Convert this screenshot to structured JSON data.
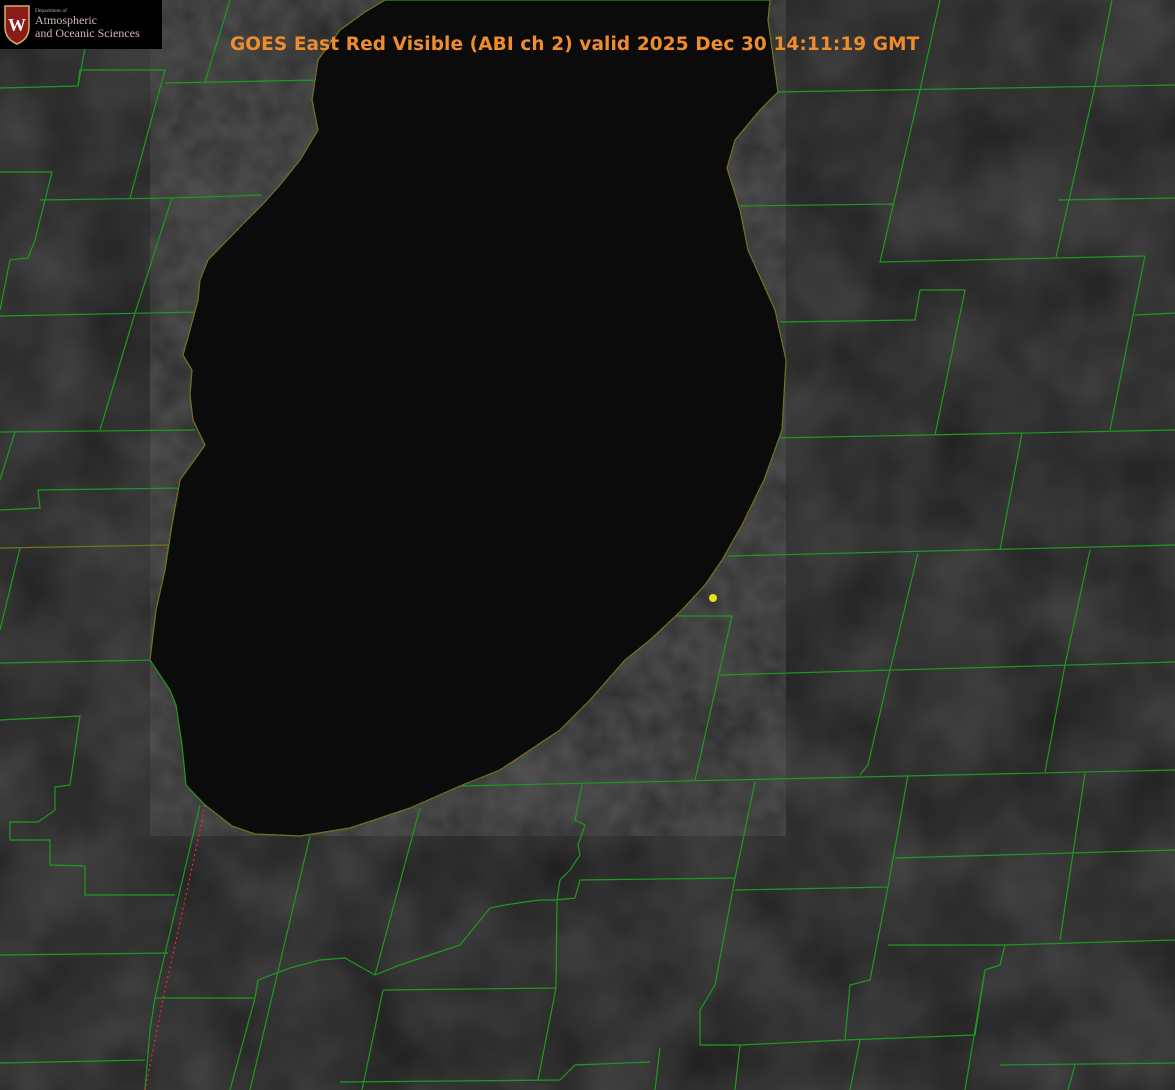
{
  "title": "GOES East Red Visible (ABI ch 2) valid 2025 Dec 30 14:11:19 GMT",
  "logo": {
    "seal_letter": "W",
    "department": "Department of",
    "line1": "Atmospheric",
    "line2": "and Oceanic Sciences"
  },
  "colors": {
    "background": "#000000",
    "land": "#1c1c1c",
    "lake": "#0d0d0d",
    "county_lines": "#1e9a1e",
    "state_lines": "#ff2a2a",
    "marker": "#e4e21a",
    "title": "#ef8c2d"
  }
}
